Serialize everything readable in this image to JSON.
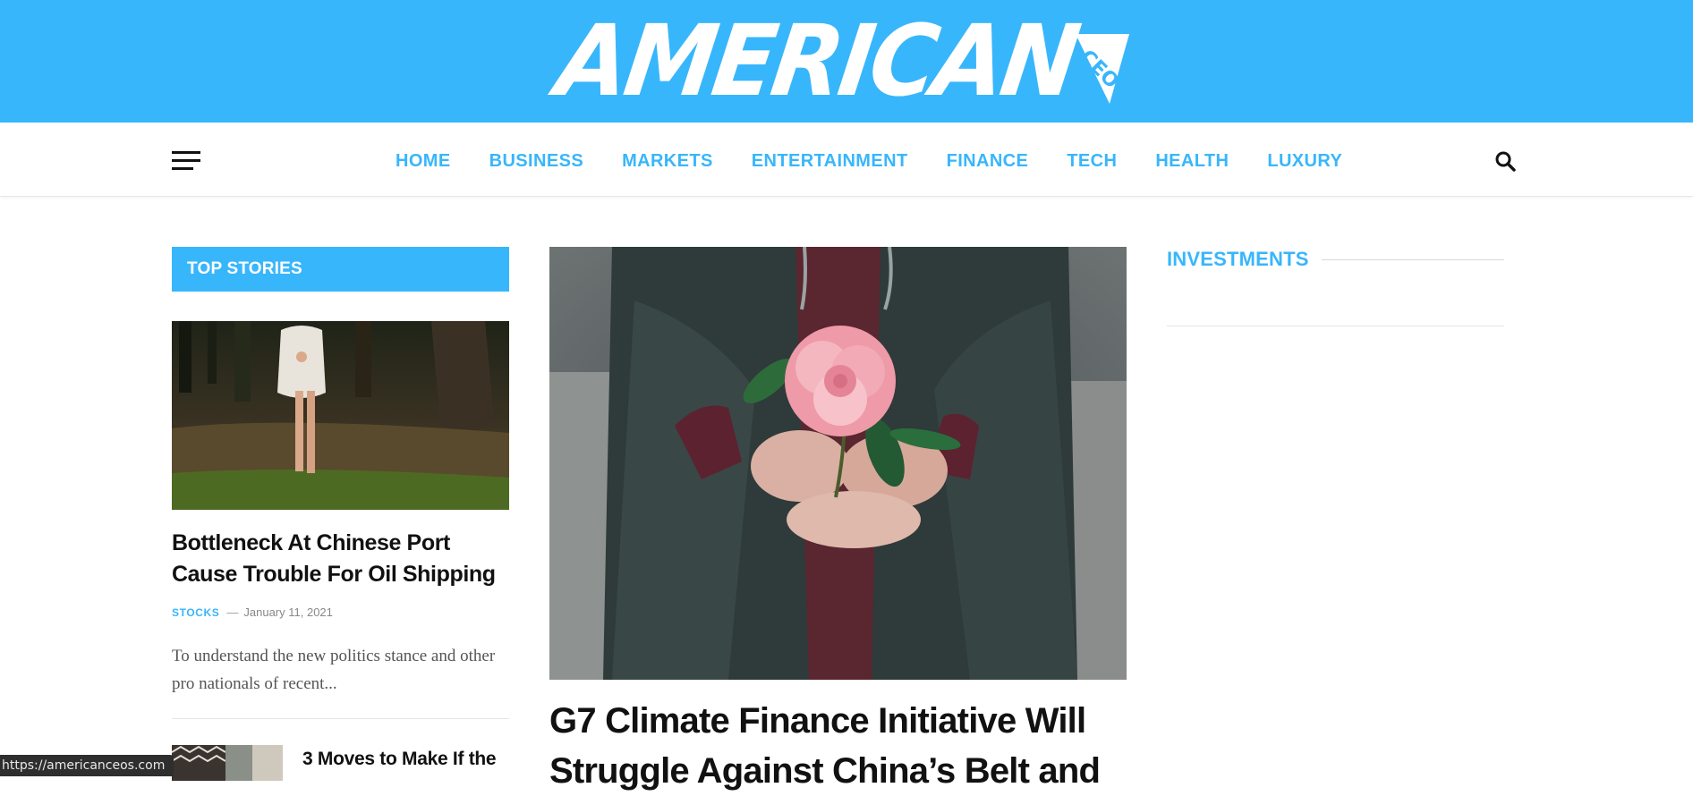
{
  "brand": {
    "logo_text": "AMERICAN",
    "logo_badge": "CEO",
    "background_color": "#38b6fb"
  },
  "nav": {
    "menu_icon": "hamburger-icon",
    "search_icon": "search-icon",
    "items": [
      {
        "label": "HOME"
      },
      {
        "label": "BUSINESS"
      },
      {
        "label": "MARKETS"
      },
      {
        "label": "ENTERTAINMENT"
      },
      {
        "label": "FINANCE"
      },
      {
        "label": "TECH"
      },
      {
        "label": "HEALTH"
      },
      {
        "label": "LUXURY"
      }
    ]
  },
  "top_stories": {
    "heading": "TOP STORIES",
    "lead": {
      "image_desc": "forest-girl-photo",
      "title": "Bottleneck At Chinese Port Cause Trouble For Oil Shipping",
      "category": "STOCKS",
      "date": "January 11, 2021",
      "excerpt": "To understand the new politics stance and other pro nationals of recent..."
    },
    "next": {
      "title": "3 Moves to Make If the"
    }
  },
  "feature": {
    "image_desc": "pink-flower-hands-photo",
    "title": "G7 Climate Finance Initiative Will Struggle Against China’s Belt and"
  },
  "sidebar": {
    "heading": "INVESTMENTS"
  },
  "status_bar": {
    "url": "https://americanceos.com"
  },
  "colors": {
    "accent": "#38b6fb",
    "text": "#111111",
    "muted": "#888888"
  }
}
